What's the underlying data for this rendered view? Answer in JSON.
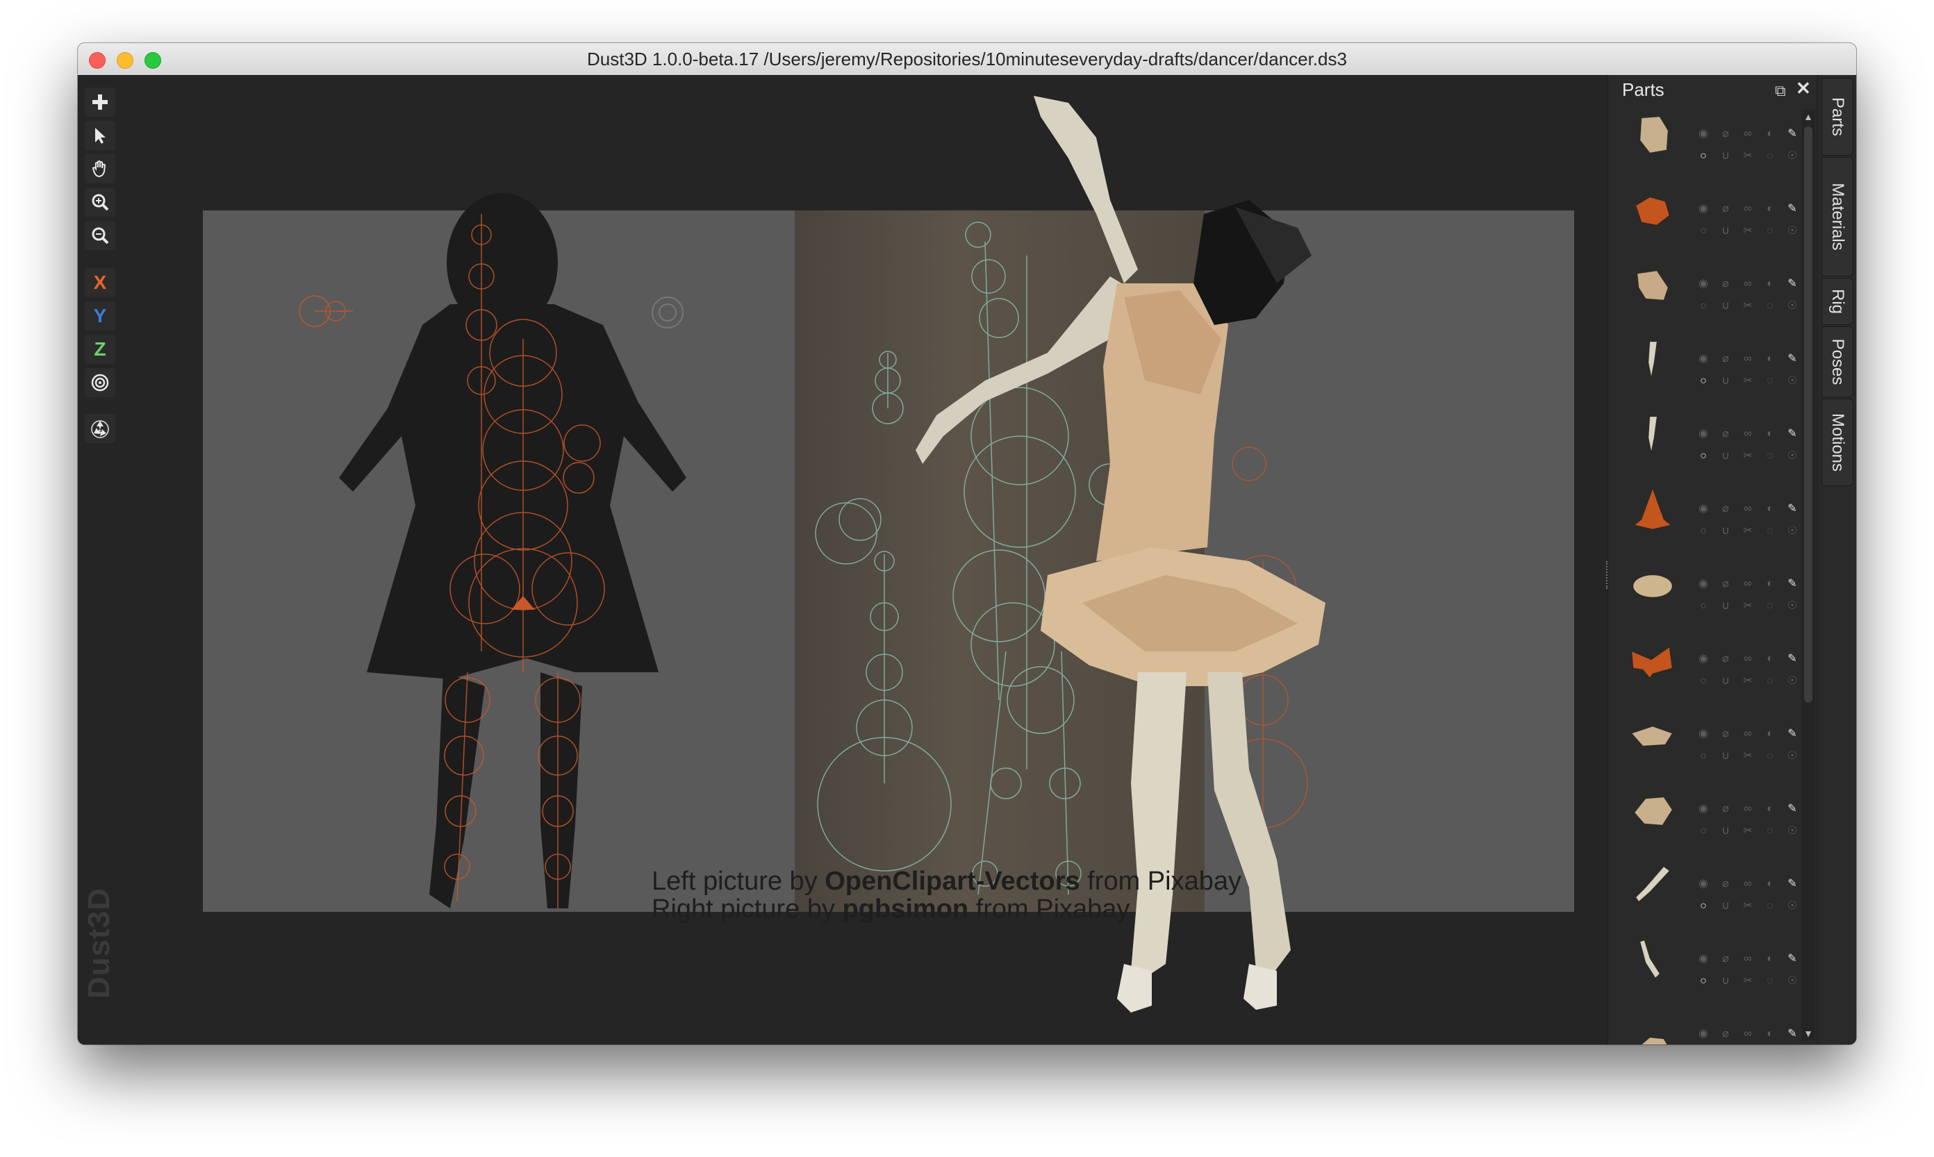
{
  "window": {
    "title": "Dust3D 1.0.0-beta.17 /Users/jeremy/Repositories/10minuteseveryday-drafts/dancer/dancer.ds3"
  },
  "toolbar": {
    "tools": [
      {
        "icon": "add-icon"
      },
      {
        "icon": "select-arrow-icon"
      },
      {
        "icon": "hand-pan-icon"
      },
      {
        "icon": "zoom-in-icon"
      },
      {
        "icon": "zoom-out-icon"
      },
      {
        "label": "X",
        "color": "#e8642a"
      },
      {
        "label": "Y",
        "color": "#3d7bd6"
      },
      {
        "label": "Z",
        "color": "#6fd06f"
      },
      {
        "icon": "radial-mirror-icon"
      },
      {
        "icon": "recycle-icon"
      }
    ]
  },
  "canvas": {
    "credit_line_1": {
      "prefix": "Left picture by ",
      "author": "OpenClipart-Vectors",
      "suffix": " from Pixabay"
    },
    "credit_line_2": {
      "prefix": "Right picture by ",
      "author": "pgbsimon",
      "suffix": " from Pixabay"
    },
    "watermark": "Dust3D"
  },
  "parts_panel": {
    "title": "Parts",
    "parts": [
      {
        "color": "#c8b08e",
        "shape": "head"
      },
      {
        "color": "#c4551f",
        "shape": "chunk"
      },
      {
        "color": "#c9aa86",
        "shape": "foot"
      },
      {
        "color": "#d9d2c0",
        "shape": "thin"
      },
      {
        "color": "#d9d2c0",
        "shape": "thin"
      },
      {
        "color": "#c4551f",
        "shape": "cone"
      },
      {
        "color": "#cdb58e",
        "shape": "disc"
      },
      {
        "color": "#c4551f",
        "shape": "bow"
      },
      {
        "color": "#c9b08c",
        "shape": "wedge"
      },
      {
        "color": "#c9b08c",
        "shape": "lips"
      },
      {
        "color": "#d9d2c0",
        "shape": "arm"
      },
      {
        "color": "#d9d2c0",
        "shape": "arm2"
      },
      {
        "color": "#c9b08c",
        "shape": "partial"
      }
    ]
  },
  "side_tabs": [
    "Parts",
    "Materials",
    "Rig",
    "Poses",
    "Motions"
  ]
}
